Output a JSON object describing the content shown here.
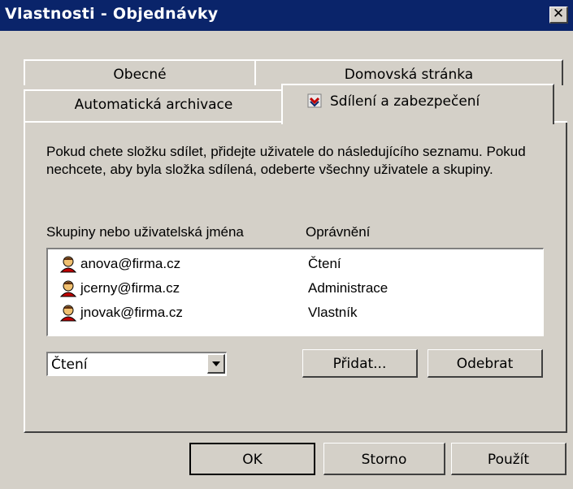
{
  "window": {
    "title": "Vlastnosti - Objednávky",
    "close_glyph": "✕"
  },
  "tabs": {
    "row1": [
      "Obecné",
      "Domovská stránka"
    ],
    "row2_inactive": "Automatická archivace",
    "active": "Sdílení a zabezpečení"
  },
  "description": "Pokud chete složku sdílet, přidejte uživatele do následujícího seznamu. Pokud nechcete, aby byla složka sdílená, odeberte všechny uživatele a skupiny.",
  "list": {
    "col_users": "Skupiny nebo uživatelská jména",
    "col_permissions": "Oprávnění",
    "rows": [
      {
        "user": "anova@firma.cz",
        "permission": "Čtení"
      },
      {
        "user": "jcerny@firma.cz",
        "permission": "Administrace"
      },
      {
        "user": "jnovak@firma.cz",
        "permission": "Vlastník"
      }
    ]
  },
  "permission_select": {
    "value": "Čtení"
  },
  "buttons": {
    "add": "Přidat...",
    "remove": "Odebrat",
    "ok": "OK",
    "cancel": "Storno",
    "apply": "Použít"
  },
  "colors": {
    "titlebar": "#0a246a",
    "face": "#d4d0c8"
  }
}
